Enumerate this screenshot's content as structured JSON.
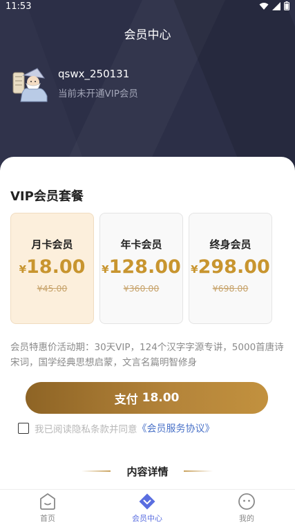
{
  "status_bar": {
    "time": "11:53",
    "icons": [
      "wifi-icon",
      "signal-icon",
      "battery-icon"
    ]
  },
  "header": {
    "title": "会员中心",
    "username": "qswx_250131",
    "vip_status": "当前未开通VIP会员"
  },
  "plans_section": {
    "title": "VIP会员套餐",
    "plans": [
      {
        "name": "月卡会员",
        "currency": "¥",
        "price": "18.00",
        "original": "¥45.00",
        "selected": true
      },
      {
        "name": "年卡会员",
        "currency": "¥",
        "price": "128.00",
        "original": "¥360.00",
        "selected": false
      },
      {
        "name": "终身会员",
        "currency": "¥",
        "price": "298.00",
        "original": "¥698.00",
        "selected": false
      }
    ]
  },
  "description": "会员特惠价活动期：30天VIP，124个汉字字源专讲，5000首唐诗宋词，国学经典思想启蒙，文言名篇明智修身",
  "pay_button": {
    "label": "支付",
    "amount": "18.00"
  },
  "agreement": {
    "checked": false,
    "text": "我已阅读隐私条款并同意",
    "link": "《会员服务协议》"
  },
  "detail_heading": "内容详情",
  "bottom_nav": {
    "items": [
      {
        "label": "首页",
        "icon": "home-icon",
        "active": false
      },
      {
        "label": "会员中心",
        "icon": "vip-diamond-icon",
        "active": true
      },
      {
        "label": "我的",
        "icon": "profile-icon",
        "active": false
      }
    ]
  },
  "colors": {
    "header_bg": "#2c2f47",
    "gold_accent": "#c8952f",
    "selected_plan_bg": "#fcefdc",
    "link_blue": "#4a72c8",
    "nav_active": "#5a6ee0"
  }
}
